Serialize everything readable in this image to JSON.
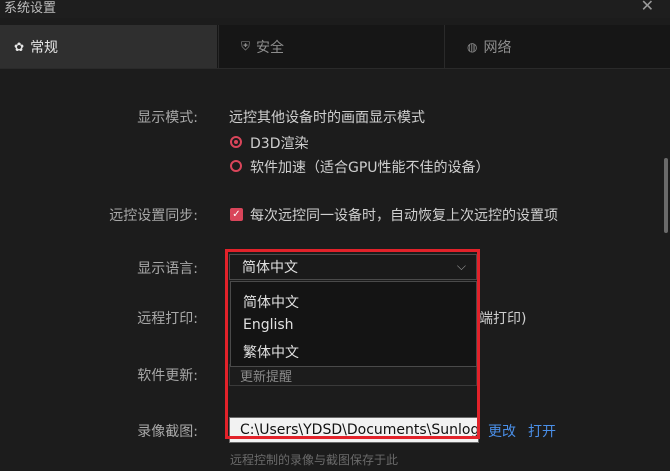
{
  "window": {
    "title": "系统设置",
    "close_icon": "close-icon"
  },
  "tabs": [
    {
      "label": "常规",
      "icon": "gear-icon"
    },
    {
      "label": "安全",
      "icon": "shield-icon"
    },
    {
      "label": "网络",
      "icon": "globe-icon"
    }
  ],
  "display_mode": {
    "label": "显示模式:",
    "desc": "远控其他设备时的画面显示模式",
    "options": [
      "D3D渲染",
      "软件加速（适合GPU性能不佳的设备）"
    ],
    "selected": "D3D渲染"
  },
  "sync": {
    "label": "远控设置同步:",
    "text": "每次远控同一设备时，自动恢复上次远控的设置项",
    "checked": true
  },
  "language": {
    "label": "显示语言:",
    "value": "简体中文",
    "options": [
      "简体中文",
      "English",
      "繁体中文"
    ]
  },
  "print": {
    "label": "远程打印:",
    "partial": "端打印)"
  },
  "update": {
    "label": "软件更新:",
    "partial": "更新提醒"
  },
  "record": {
    "label": "录像截图:",
    "path": "C:\\Users\\YDSD\\Documents\\Sunlogin",
    "change": "更改",
    "open": "打开",
    "note": "远程控制的录像与截图保存于此"
  },
  "colors": {
    "accent": "#d9455a",
    "highlight": "#e2222a",
    "link": "#4a8fe8"
  }
}
